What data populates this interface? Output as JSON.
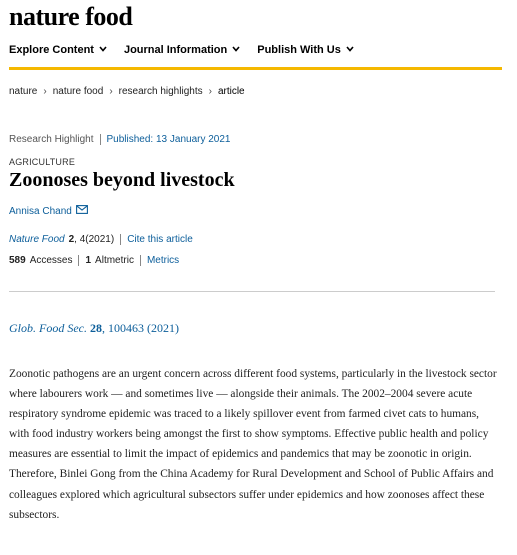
{
  "header": {
    "logo": "nature food",
    "nav": [
      {
        "label": "Explore Content"
      },
      {
        "label": "Journal Information"
      },
      {
        "label": "Publish With Us"
      }
    ]
  },
  "breadcrumb": {
    "items": [
      "nature",
      "nature food",
      "research highlights"
    ],
    "current": "article"
  },
  "article": {
    "type": "Research Highlight",
    "published_label": "Published: 13 January 2021",
    "subject": "AGRICULTURE",
    "title": "Zoonoses beyond livestock",
    "author": "Annisa Chand",
    "citation": {
      "journal": "Nature Food",
      "volume": "2",
      "rest": ", 4(2021)",
      "cite_link": "Cite this article"
    },
    "metrics": {
      "accesses_count": "589",
      "accesses_label": "Accesses",
      "altmetric_count": "1",
      "altmetric_label": "Altmetric",
      "metrics_link": "Metrics"
    },
    "reference": {
      "journal": "Glob. Food Sec.",
      "volume": "28",
      "rest": ", 100463 (2021)"
    },
    "body": "Zoonotic pathogens are an urgent concern across different food systems, particularly in the livestock sector where labourers work — and sometimes live — alongside their animals. The 2002–2004 severe acute respiratory syndrome epidemic was traced to a likely spillover event from farmed civet cats to humans, with food industry workers being amongst the first to show symptoms. Effective public health and policy measures are essential to limit the impact of epidemics and pandemics that may be zoonotic in origin. Therefore, Binlei Gong from the China Academy for Rural Development and School of Public Affairs and colleagues explored which agricultural subsectors suffer under epidemics and how zoonoses affect these subsectors."
  },
  "colors": {
    "accent": "#f5b800",
    "link": "#0c5e9a"
  }
}
